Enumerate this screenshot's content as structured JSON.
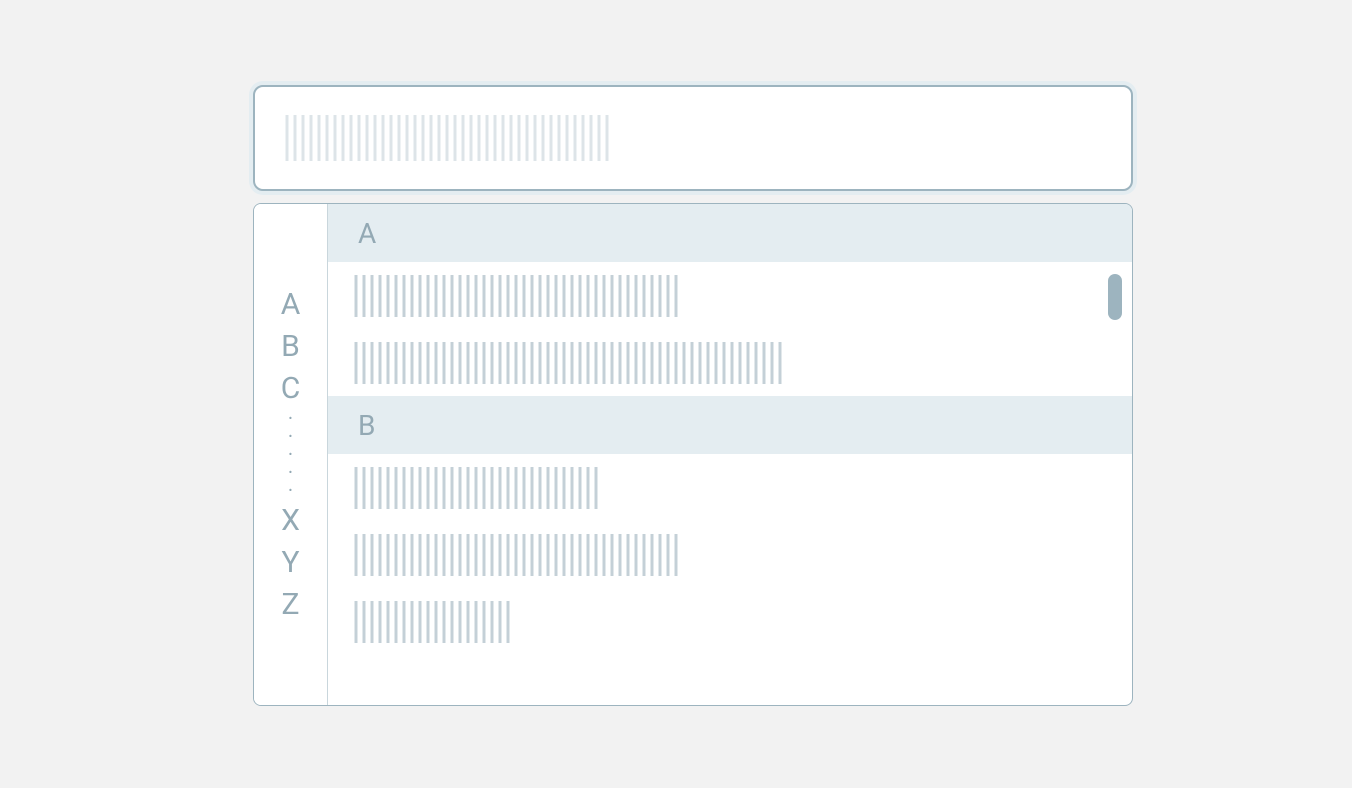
{
  "search": {
    "placeholder": ""
  },
  "alpha_index": {
    "top": [
      "A",
      "B",
      "C"
    ],
    "ellipsis_count": 5,
    "bottom": [
      "X",
      "Y",
      "Z"
    ]
  },
  "sections": [
    {
      "label": "A",
      "item_widths": [
        324,
        432
      ]
    },
    {
      "label": "B",
      "item_widths": [
        248,
        326,
        158
      ]
    }
  ],
  "colors": {
    "background": "#f2f2f2",
    "surface": "#ffffff",
    "border": "#9db4bf",
    "focus_ring": "#e4edf1",
    "muted_text": "#93a9b4",
    "section_bg": "#e4edf1",
    "hatch": "#c4d0d7",
    "hatch_light": "#dde4e8"
  },
  "scrollbar": {
    "visible": true
  }
}
